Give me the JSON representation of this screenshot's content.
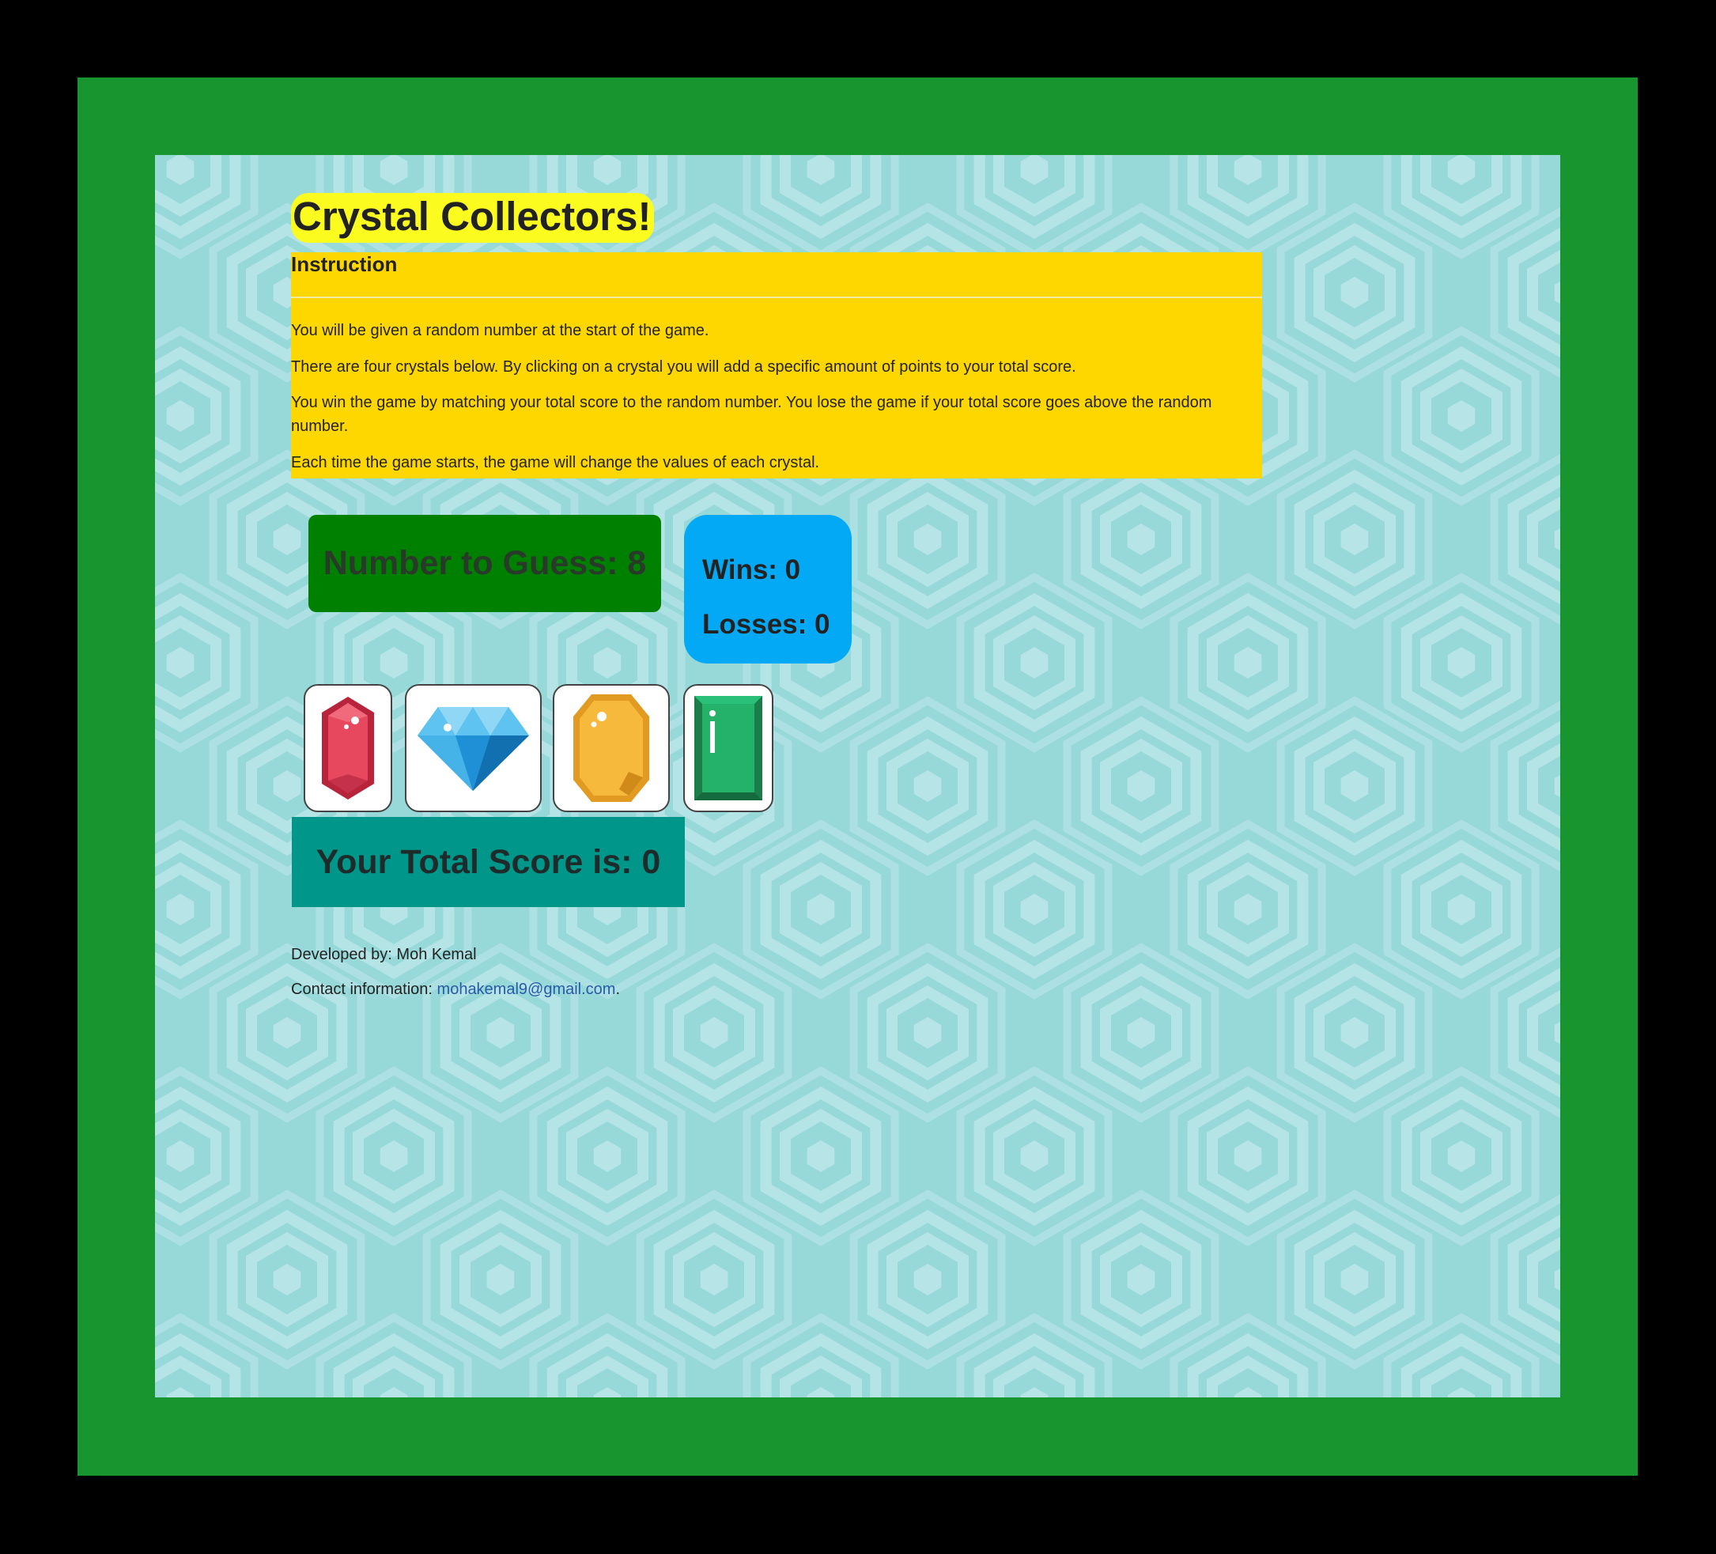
{
  "colors": {
    "outer_bg": "#000000",
    "frame": "#18952f",
    "play_area": "#97d8d9",
    "hex_pattern": "#bfe8ea",
    "title_highlight": "#fbfb1f",
    "instruction_bg": "#ffd700",
    "target_bg": "#008000",
    "stats_bg": "#03a9f4",
    "score_bg": "#00968a",
    "link": "#2b5aa8"
  },
  "header": {
    "title": "Crystal Collectors!"
  },
  "instructions": {
    "heading": "Instruction",
    "paragraphs": [
      "You will be given a random number at the start of the game.",
      "There are four crystals below. By clicking on a crystal you will add a specific amount of points to your total score.",
      "You win the game by matching your total score to the random number. You lose the game if your total score goes above the random number.",
      "Each time the game starts, the game will change the values of each crystal."
    ]
  },
  "target": {
    "label": "Number to Guess: 8"
  },
  "stats": {
    "wins": "Wins: 0",
    "losses": "Losses: 0"
  },
  "crystals": [
    {
      "icon": "red-gem-icon"
    },
    {
      "icon": "blue-diamond-icon"
    },
    {
      "icon": "yellow-gem-icon"
    },
    {
      "icon": "green-emerald-icon"
    }
  ],
  "score": {
    "label": "Your Total Score is: 0"
  },
  "footer": {
    "developer": "Developed by: Moh Kemal",
    "contact_prefix": "Contact information: ",
    "email": "mohakemal9@gmail.com",
    "contact_suffix": "."
  }
}
